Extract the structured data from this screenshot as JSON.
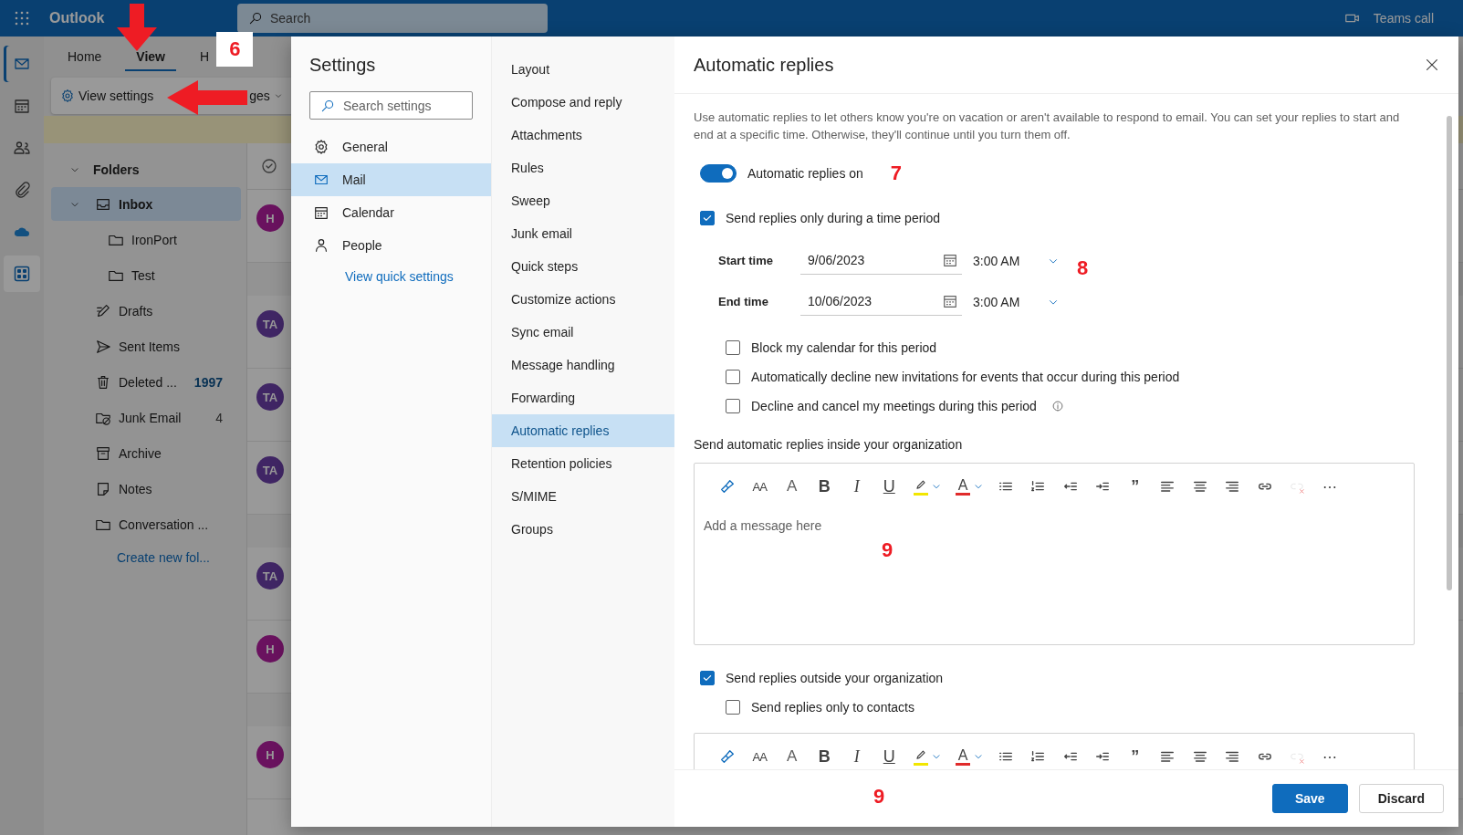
{
  "app": {
    "name": "Outlook",
    "search": {
      "placeholder": "Search"
    },
    "teams_call": "Teams call"
  },
  "rail": [
    {
      "kind": "mail",
      "selected": true
    },
    {
      "kind": "calendar",
      "selected": false
    },
    {
      "kind": "people",
      "selected": false
    },
    {
      "kind": "attach",
      "selected": false
    },
    {
      "kind": "cloud",
      "selected": false
    },
    {
      "kind": "apps",
      "selected": false
    }
  ],
  "ribbon": {
    "tabs": [
      {
        "label": "Home",
        "selected": false
      },
      {
        "label": "View",
        "selected": true,
        "annotation": "6"
      },
      {
        "label": "H",
        "selected": false
      }
    ],
    "buttons": [
      {
        "label": "View settings",
        "kind": "settings"
      },
      {
        "label": "ges",
        "kind": "dropdown"
      }
    ]
  },
  "folders": {
    "title": "Folders",
    "items": [
      {
        "label": "Inbox",
        "kind": "inbox",
        "selected": true,
        "children": [
          {
            "label": "IronPort",
            "kind": "folder",
            "selected": false
          },
          {
            "label": "Test",
            "kind": "folder",
            "selected": false
          }
        ]
      },
      {
        "label": "Drafts",
        "kind": "drafts",
        "selected": false
      },
      {
        "label": "Sent Items",
        "kind": "sent",
        "selected": false
      },
      {
        "label": "Deleted ...",
        "kind": "trash",
        "selected": false,
        "count": "1997",
        "unread": true
      },
      {
        "label": "Junk Email",
        "kind": "junk",
        "selected": false,
        "count": "4",
        "unread": false
      },
      {
        "label": "Archive",
        "kind": "archive",
        "selected": false
      },
      {
        "label": "Notes",
        "kind": "notes",
        "selected": false
      },
      {
        "label": "Conversation ...",
        "kind": "folder",
        "selected": false
      }
    ],
    "create_link": "Create new fol..."
  },
  "message_list": {
    "rows": [
      {
        "kind": "message",
        "initials": "H",
        "color": "#6a125f"
      },
      {
        "kind": "group"
      },
      {
        "kind": "message",
        "initials": "TA",
        "color": "#402665"
      },
      {
        "kind": "message",
        "initials": "TA",
        "color": "#402665"
      },
      {
        "kind": "message",
        "initials": "TA",
        "color": "#402665"
      },
      {
        "kind": "group"
      },
      {
        "kind": "message",
        "initials": "TA",
        "color": "#402665"
      },
      {
        "kind": "message",
        "initials": "H",
        "color": "#6a125f"
      },
      {
        "kind": "group"
      },
      {
        "kind": "message",
        "initials": "H",
        "color": "#6a125f"
      }
    ]
  },
  "settings": {
    "title": "Settings",
    "search": {
      "placeholder": "Search settings"
    },
    "nav": [
      {
        "label": "General",
        "kind": "general",
        "selected": false
      },
      {
        "label": "Mail",
        "kind": "mail",
        "selected": true
      },
      {
        "label": "Calendar",
        "kind": "calendar",
        "selected": false
      },
      {
        "label": "People",
        "kind": "people",
        "selected": false
      }
    ],
    "quick_link": "View quick settings",
    "categories": [
      {
        "label": "Layout",
        "selected": false
      },
      {
        "label": "Compose and reply",
        "selected": false
      },
      {
        "label": "Attachments",
        "selected": false
      },
      {
        "label": "Rules",
        "selected": false
      },
      {
        "label": "Sweep",
        "selected": false
      },
      {
        "label": "Junk email",
        "selected": false
      },
      {
        "label": "Quick steps",
        "selected": false
      },
      {
        "label": "Customize actions",
        "selected": false
      },
      {
        "label": "Sync email",
        "selected": false
      },
      {
        "label": "Message handling",
        "selected": false
      },
      {
        "label": "Forwarding",
        "selected": false
      },
      {
        "label": "Automatic replies",
        "selected": true
      },
      {
        "label": "Retention policies",
        "selected": false
      },
      {
        "label": "S/MIME",
        "selected": false
      },
      {
        "label": "Groups",
        "selected": false
      }
    ]
  },
  "panel": {
    "title": "Automatic replies",
    "description": "Use automatic replies to let others know you're on vacation or aren't available to respond to email. You can set your replies to start and end at a specific time. Otherwise, they'll continue until you turn them off.",
    "toggle": {
      "label": "Automatic replies on",
      "on": true,
      "annotation": "7"
    },
    "time_period": {
      "label": "Send replies only during a time period",
      "checked": true
    },
    "times": [
      {
        "label": "Start time",
        "date": "9/06/2023",
        "time": "3:00 AM"
      },
      {
        "label": "End time",
        "date": "10/06/2023",
        "time": "3:00 AM"
      }
    ],
    "times_annotation": "8",
    "options": [
      {
        "label": "Block my calendar for this period",
        "checked": false,
        "info": false
      },
      {
        "label": "Automatically decline new invitations for events that occur during this period",
        "checked": false,
        "info": false
      },
      {
        "label": "Decline and cancel my meetings during this period",
        "checked": false,
        "info": true
      }
    ],
    "inside_heading": "Send automatic replies inside your organization",
    "editors": [
      {
        "placeholder": "Add a message here",
        "annotation": "9",
        "toolbar": [
          {
            "kind": "brush",
            "disabled": false
          },
          {
            "kind": "fontsize",
            "glyph": "AA",
            "disabled": false
          },
          {
            "kind": "grow",
            "glyph": "A",
            "disabled": false
          },
          {
            "kind": "bold",
            "glyph": "B",
            "disabled": false
          },
          {
            "kind": "italic",
            "glyph": "I",
            "disabled": false
          },
          {
            "kind": "underline",
            "glyph": "U",
            "disabled": false
          },
          {
            "kind": "marker",
            "color": "#f2e600",
            "disabled": false
          },
          {
            "kind": "fontcolor",
            "glyph": "A",
            "color": "#e02b2b",
            "disabled": false
          },
          {
            "kind": "bullets",
            "disabled": false
          },
          {
            "kind": "numbers",
            "disabled": false
          },
          {
            "kind": "outdent",
            "disabled": false
          },
          {
            "kind": "indent",
            "disabled": false
          },
          {
            "kind": "quote",
            "glyph": "”",
            "disabled": false
          },
          {
            "kind": "alignleft",
            "disabled": false
          },
          {
            "kind": "aligncenter",
            "disabled": false
          },
          {
            "kind": "alignright",
            "disabled": false
          },
          {
            "kind": "link",
            "disabled": false
          },
          {
            "kind": "unlink",
            "disabled": true
          },
          {
            "kind": "more",
            "glyph": "⋯",
            "disabled": false
          }
        ]
      }
    ],
    "outside": {
      "label": "Send replies outside your organization",
      "checked": true
    },
    "contacts_only": {
      "label": "Send replies only to contacts",
      "checked": false
    },
    "editors2": [
      {
        "toolbar": [
          {
            "kind": "brush",
            "disabled": false
          },
          {
            "kind": "fontsize",
            "glyph": "AA",
            "disabled": false
          },
          {
            "kind": "grow",
            "glyph": "A",
            "disabled": false
          },
          {
            "kind": "bold",
            "glyph": "B",
            "disabled": false
          },
          {
            "kind": "italic",
            "glyph": "I",
            "disabled": false
          },
          {
            "kind": "underline",
            "glyph": "U",
            "disabled": false
          },
          {
            "kind": "marker",
            "color": "#f2e600",
            "disabled": false
          },
          {
            "kind": "fontcolor",
            "glyph": "A",
            "color": "#e02b2b",
            "disabled": false
          },
          {
            "kind": "bullets",
            "disabled": false
          },
          {
            "kind": "numbers",
            "disabled": false
          },
          {
            "kind": "outdent",
            "disabled": false
          },
          {
            "kind": "indent",
            "disabled": false
          },
          {
            "kind": "quote",
            "glyph": "”",
            "disabled": false
          },
          {
            "kind": "alignleft",
            "disabled": false
          },
          {
            "kind": "aligncenter",
            "disabled": false
          },
          {
            "kind": "alignright",
            "disabled": false
          },
          {
            "kind": "link",
            "disabled": false
          },
          {
            "kind": "unlink",
            "disabled": true
          },
          {
            "kind": "more",
            "glyph": "⋯",
            "disabled": false
          }
        ]
      }
    ],
    "buttons": [
      {
        "label": "Save",
        "primary": true
      },
      {
        "label": "Discard",
        "primary": false
      }
    ],
    "footer_annotation": "9"
  }
}
